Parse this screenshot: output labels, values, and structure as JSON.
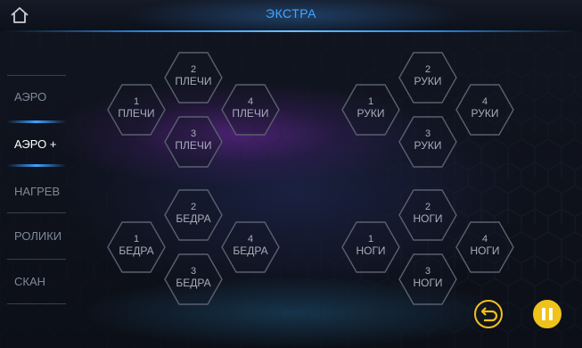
{
  "header": {
    "title": "ЭКСТРА",
    "home_icon": "home-icon"
  },
  "sidebar": {
    "items": [
      {
        "label": "АЭРО",
        "active": false
      },
      {
        "label": "АЭРО +",
        "active": true
      },
      {
        "label": "НАГРЕВ",
        "active": false
      },
      {
        "label": "РОЛИКИ",
        "active": false
      },
      {
        "label": "СКАН",
        "active": false
      }
    ]
  },
  "groups": [
    {
      "name": "ПЛЕЧИ",
      "zones": [
        {
          "num": "1",
          "label": "ПЛЕЧИ"
        },
        {
          "num": "2",
          "label": "ПЛЕЧИ"
        },
        {
          "num": "3",
          "label": "ПЛЕЧИ"
        },
        {
          "num": "4",
          "label": "ПЛЕЧИ"
        }
      ]
    },
    {
      "name": "РУКИ",
      "zones": [
        {
          "num": "1",
          "label": "РУКИ"
        },
        {
          "num": "2",
          "label": "РУКИ"
        },
        {
          "num": "3",
          "label": "РУКИ"
        },
        {
          "num": "4",
          "label": "РУКИ"
        }
      ]
    },
    {
      "name": "БЕДРА",
      "zones": [
        {
          "num": "1",
          "label": "БЕДРА"
        },
        {
          "num": "2",
          "label": "БЕДРА"
        },
        {
          "num": "3",
          "label": "БЕДРА"
        },
        {
          "num": "4",
          "label": "БЕДРА"
        }
      ]
    },
    {
      "name": "НОГИ",
      "zones": [
        {
          "num": "1",
          "label": "НОГИ"
        },
        {
          "num": "2",
          "label": "НОГИ"
        },
        {
          "num": "3",
          "label": "НОГИ"
        },
        {
          "num": "4",
          "label": "НОГИ"
        }
      ]
    }
  ],
  "controls": {
    "back_icon": "undo-arrow-icon",
    "pause_icon": "pause-icon"
  },
  "colors": {
    "accent": "#43a6ff",
    "button": "#f0c21c"
  }
}
